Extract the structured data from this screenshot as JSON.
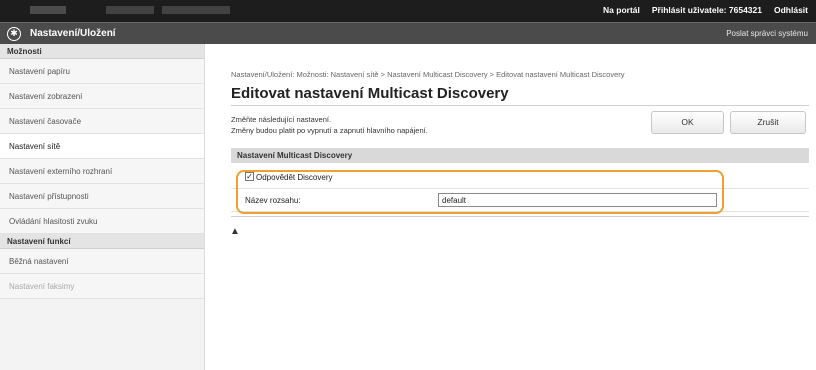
{
  "topbar": {
    "portal_link": "Na portál",
    "login_text": "Přihlásit uživatele:",
    "user_id": "7654321",
    "logout_link": "Odhlásit"
  },
  "titlebar": {
    "app_title": "Nastavení/Uložení",
    "mail_link": "Poslat správci systému"
  },
  "sidebar": {
    "sections": [
      {
        "heading": "Možnosti",
        "items": [
          "Nastavení papíru",
          "Nastavení zobrazení",
          "Nastavení časovače",
          "Nastavení sítě",
          "Nastavení externího rozhraní",
          "Nastavení přístupnosti",
          "Ovládání hlasitosti zvuku"
        ]
      },
      {
        "heading": "Nastavení funkcí",
        "items": [
          "Běžná nastavení",
          "Nastavení faksimy"
        ]
      }
    ],
    "active_item": "Nastavení sítě"
  },
  "main": {
    "breadcrumb": "Nastavení/Uložení: Možnosti: Nastavení sítě > Nastavení Multicast Discovery > Editovat nastavení Multicast Discovery",
    "title": "Editovat nastavení Multicast Discovery",
    "instruction_line1": "Změňte následující nastavení.",
    "instruction_line2": "Změny budou platit po vypnutí a zapnutí hlavního napájení.",
    "ok_label": "OK",
    "cancel_label": "Zrušit",
    "section_heading": "Nastavení Multicast Discovery",
    "discovery_checkbox": {
      "label": "Odpovědět Discovery",
      "checked": true
    },
    "scope_name": {
      "label": "Název rozsahu:",
      "value": "default"
    },
    "top_link_glyph": "▲"
  },
  "colors": {
    "topbar": "#1d1d1d",
    "titlebar": "#4b4b4b",
    "highlight": "#f0a030",
    "section_head": "#d9d9d9"
  }
}
